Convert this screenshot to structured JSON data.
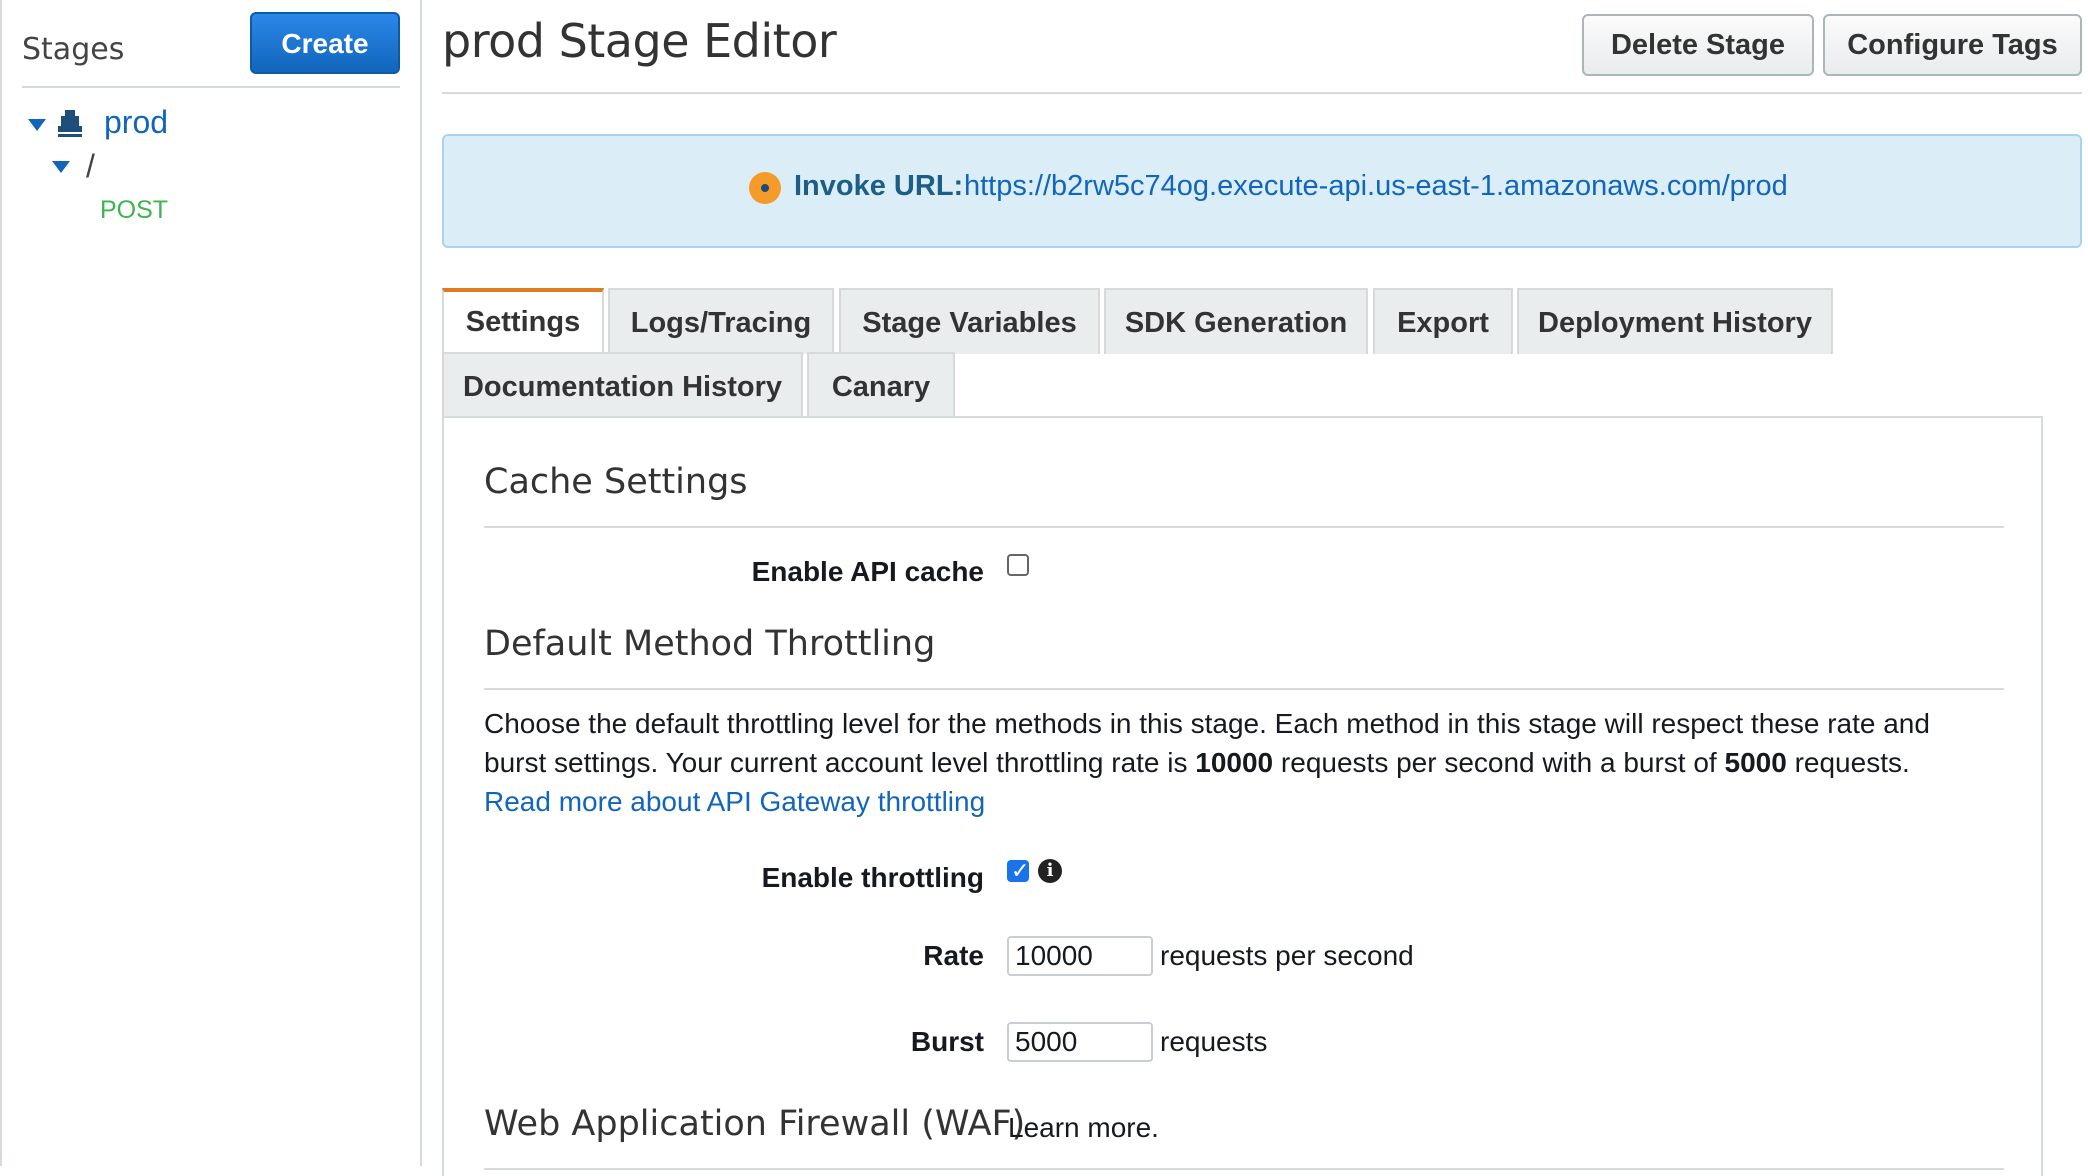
{
  "sidebar": {
    "title": "Stages",
    "create_label": "Create",
    "tree": {
      "stage": "prod",
      "resource": "/",
      "method": "POST"
    }
  },
  "header": {
    "title": "prod Stage Editor",
    "delete_label": "Delete Stage",
    "tags_label": "Configure Tags"
  },
  "invoke": {
    "label": "Invoke URL:",
    "url": "https://b2rw5c74og.execute-api.us-east-1.amazonaws.com/prod"
  },
  "tabs": [
    {
      "label": "Settings",
      "active": true
    },
    {
      "label": "Logs/Tracing"
    },
    {
      "label": "Stage Variables"
    },
    {
      "label": "SDK Generation"
    },
    {
      "label": "Export"
    },
    {
      "label": "Deployment History"
    },
    {
      "label": "Documentation History"
    },
    {
      "label": "Canary"
    }
  ],
  "cache": {
    "title": "Cache Settings",
    "enable_label": "Enable API cache",
    "enabled": false
  },
  "throttling": {
    "title": "Default Method Throttling",
    "desc_1": "Choose the default throttling level for the methods in this stage. Each method in this stage will respect these rate and burst settings. Your current account level throttling rate is ",
    "rate_bold": "10000",
    "desc_2": " requests per second with a burst of ",
    "burst_bold": "5000",
    "desc_3": " requests.",
    "read_more": "Read more about API Gateway throttling",
    "enable_label": "Enable throttling",
    "enabled": true,
    "rate_label": "Rate",
    "rate_value": "10000",
    "rate_unit": "requests per second",
    "burst_label": "Burst",
    "burst_value": "5000",
    "burst_unit": "requests"
  },
  "waf": {
    "title": "Web Application Firewall (WAF)",
    "learn_more": "Learn more."
  },
  "colors": {
    "primary": "#1166bb",
    "active_tab_accent": "#e07b1f",
    "method_post": "#3fb34f",
    "invoke_bg": "#dbeef8"
  }
}
